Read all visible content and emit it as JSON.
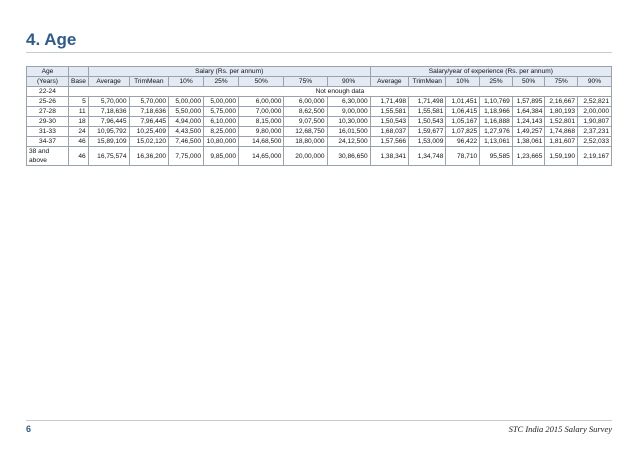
{
  "page": {
    "title": "4. Age",
    "page_number": "6",
    "footer": "STC India 2015 Salary Survey"
  },
  "table": {
    "header_age_top": "Age",
    "header_age_bottom": "(Years)",
    "header_base": "Base",
    "group_salary": "Salary (Rs. per annum)",
    "group_salary_per_year": "Salary/year of experience (Rs. per annum)",
    "subcols": [
      "Average",
      "TrimMean",
      "10%",
      "25%",
      "50%",
      "75%",
      "90%"
    ],
    "no_data_text": "Not enough data",
    "rows": [
      {
        "age": "22-24",
        "no_data": true
      },
      {
        "age": "25-26",
        "base": "5",
        "salary": [
          "5,70,000",
          "5,70,000",
          "5,00,000",
          "5,00,000",
          "6,00,000",
          "6,00,000",
          "6,30,000"
        ],
        "per_year": [
          "1,71,498",
          "1,71,498",
          "1,01,451",
          "1,10,769",
          "1,57,895",
          "2,16,667",
          "2,52,821"
        ]
      },
      {
        "age": "27-28",
        "base": "11",
        "salary": [
          "7,18,636",
          "7,18,636",
          "5,50,000",
          "5,75,000",
          "7,00,000",
          "8,62,500",
          "9,00,000"
        ],
        "per_year": [
          "1,55,581",
          "1,55,581",
          "1,06,415",
          "1,18,966",
          "1,64,384",
          "1,80,193",
          "2,00,000"
        ]
      },
      {
        "age": "29-30",
        "base": "18",
        "salary": [
          "7,96,445",
          "7,96,445",
          "4,94,000",
          "6,10,000",
          "8,15,000",
          "9,07,500",
          "10,30,000"
        ],
        "per_year": [
          "1,50,543",
          "1,50,543",
          "1,05,167",
          "1,16,888",
          "1,24,143",
          "1,52,801",
          "1,90,807"
        ]
      },
      {
        "age": "31-33",
        "base": "24",
        "salary": [
          "10,95,792",
          "10,25,409",
          "4,43,500",
          "8,25,000",
          "9,80,000",
          "12,68,750",
          "16,01,500"
        ],
        "per_year": [
          "1,68,037",
          "1,59,677",
          "1,07,825",
          "1,27,976",
          "1,49,257",
          "1,74,868",
          "2,37,231"
        ]
      },
      {
        "age": "34-37",
        "base": "46",
        "salary": [
          "15,89,109",
          "15,02,120",
          "7,46,500",
          "10,80,000",
          "14,68,500",
          "18,80,000",
          "24,12,500"
        ],
        "per_year": [
          "1,57,566",
          "1,53,009",
          "96,422",
          "1,13,061",
          "1,38,061",
          "1,81,607",
          "2,52,033"
        ]
      },
      {
        "age": "38 and above",
        "base": "46",
        "salary": [
          "16,75,574",
          "16,36,200",
          "7,75,000",
          "9,85,000",
          "14,65,000",
          "20,00,000",
          "30,86,650"
        ],
        "per_year": [
          "1,38,341",
          "1,34,748",
          "78,710",
          "95,585",
          "1,23,665",
          "1,59,190",
          "2,19,167"
        ]
      }
    ]
  }
}
